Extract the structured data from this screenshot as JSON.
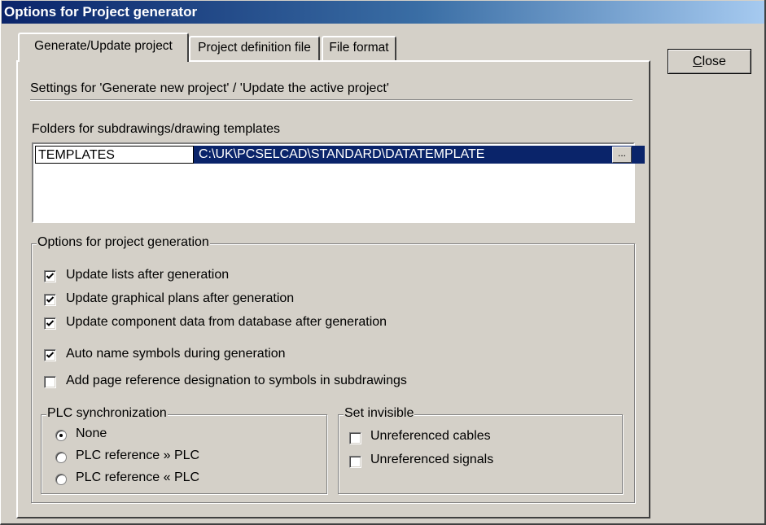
{
  "window": {
    "title": "Options for Project generator"
  },
  "tabs": [
    {
      "label": "Generate/Update project",
      "active": true
    },
    {
      "label": "Project definition file",
      "active": false
    },
    {
      "label": "File format",
      "active": false
    }
  ],
  "buttons": {
    "close_label": "Close"
  },
  "panel": {
    "settings_heading": "Settings for 'Generate new project' / 'Update the active project'",
    "folders_label": "Folders for subdrawings/drawing templates",
    "folders": [
      {
        "name": "TEMPLATES",
        "path": "C:\\UK\\PCSELCAD\\STANDARD\\DATATEMPLATE",
        "browse": "..."
      }
    ],
    "generation_group": {
      "title": "Options for project generation",
      "options": [
        {
          "label": "Update lists after generation",
          "checked": true
        },
        {
          "label": "Update graphical plans after generation",
          "checked": true
        },
        {
          "label": "Update component data from database after generation",
          "checked": true
        },
        {
          "label": "Auto name symbols during generation",
          "checked": true
        },
        {
          "label": "Add page reference designation to symbols in subdrawings",
          "checked": false
        }
      ]
    },
    "plc_group": {
      "title": "PLC synchronization",
      "options": [
        {
          "label": "None",
          "selected": true
        },
        {
          "label": "PLC reference » PLC",
          "selected": false
        },
        {
          "label": "PLC reference « PLC",
          "selected": false
        }
      ]
    },
    "invisible_group": {
      "title": "Set invisible",
      "options": [
        {
          "label": "Unreferenced cables",
          "checked": false
        },
        {
          "label": "Unreferenced signals",
          "checked": false
        }
      ]
    }
  },
  "colors": {
    "face": "#d4d0c8",
    "selection": "#0a246a",
    "title_start": "#0a246a"
  }
}
